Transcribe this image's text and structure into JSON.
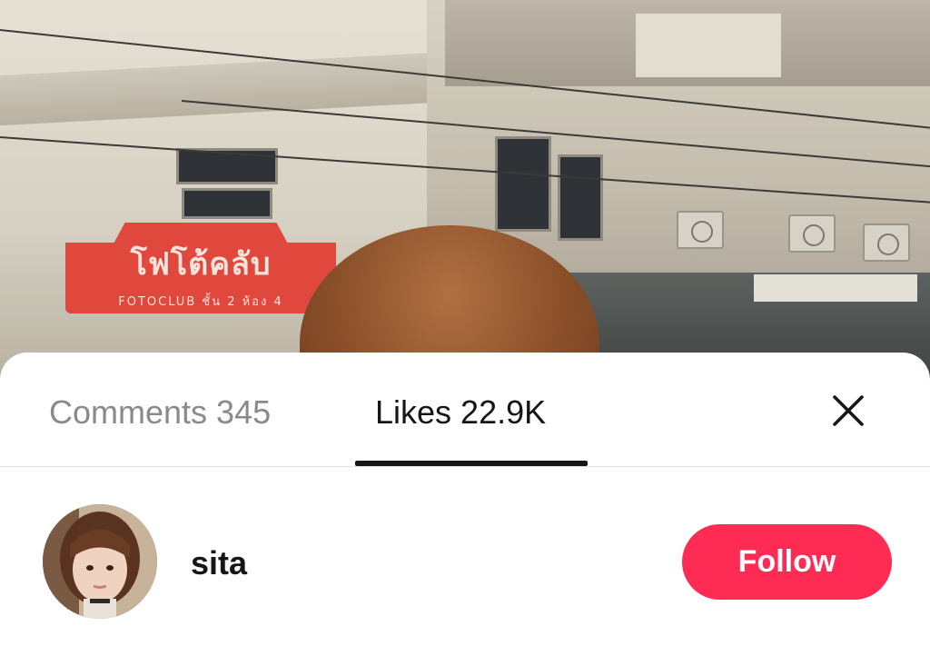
{
  "photo": {
    "sign_text": "โฟโต้คลับ",
    "sign_subtext": "FOTOCLUB ชั้น 2 ห้อง 4"
  },
  "tabs": [
    {
      "label": "Comments 345",
      "selected": false
    },
    {
      "label": "Likes 22.9K",
      "selected": true
    }
  ],
  "close_icon": "close-icon",
  "user": {
    "name": "sita",
    "avatar_icon": "user-avatar",
    "follow_label": "Follow"
  },
  "colors": {
    "follow_button": "#fe2c55",
    "tab_active": "#161616",
    "tab_inactive": "#8a8a8a",
    "sign_red": "#e0483d"
  }
}
